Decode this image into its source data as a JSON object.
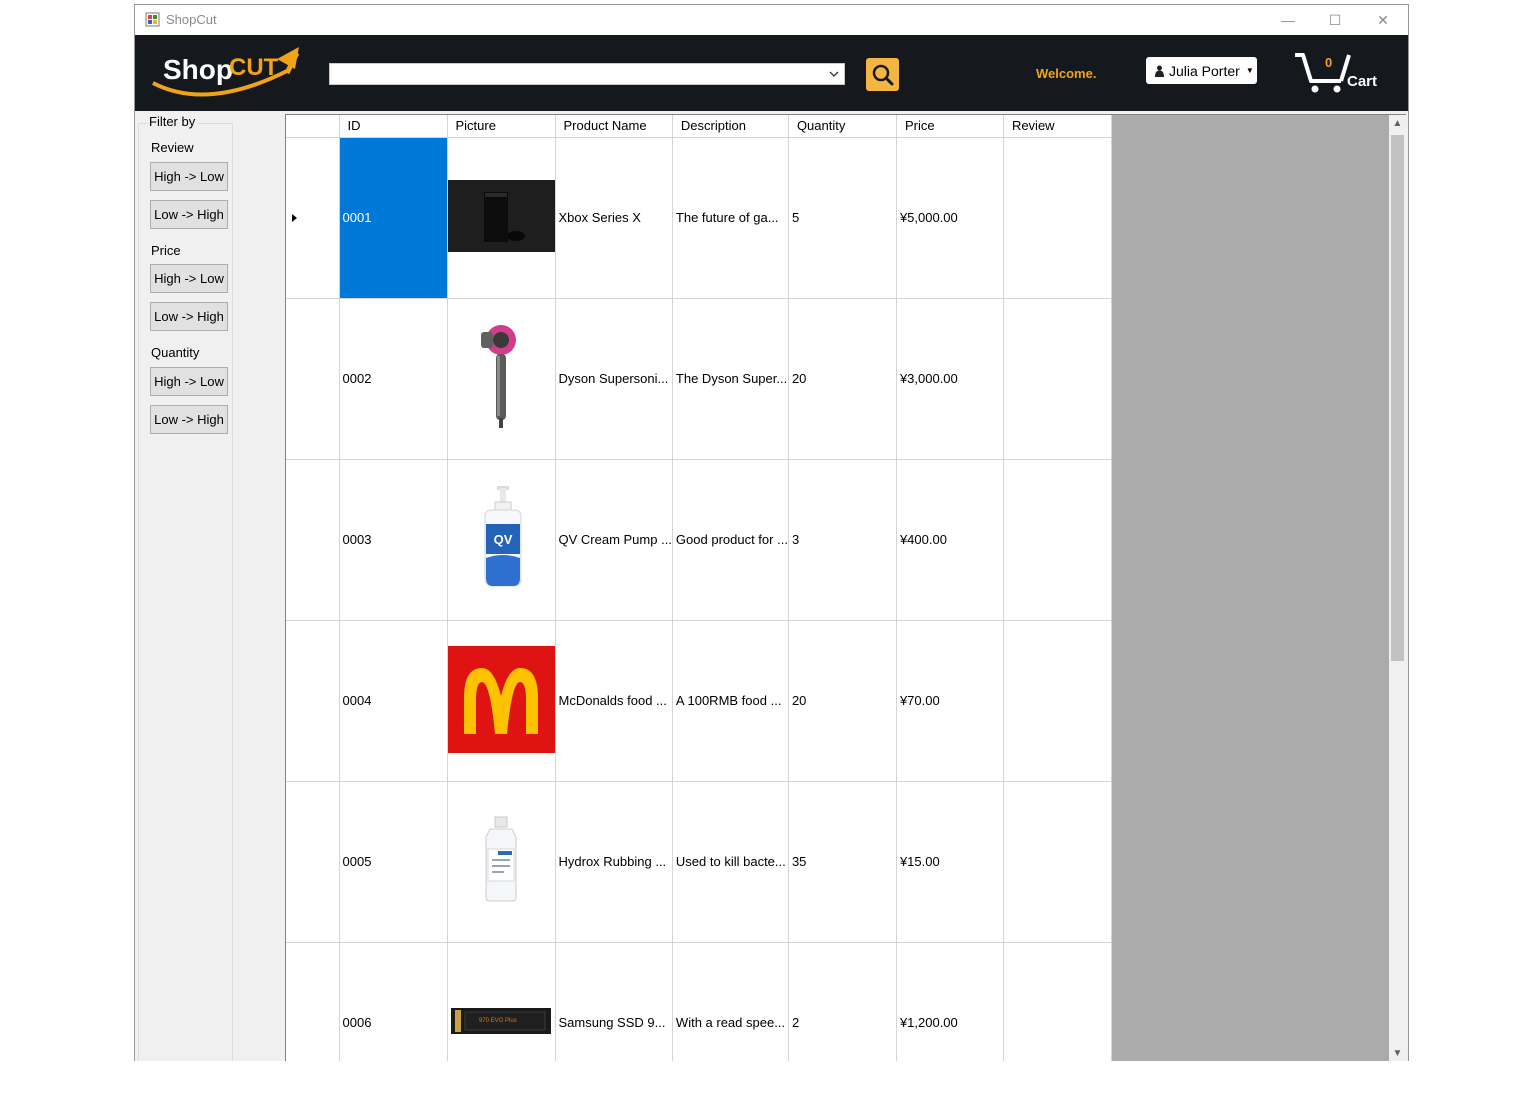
{
  "window": {
    "title": "ShopCut",
    "minimize_glyph": "—",
    "maximize_glyph": "☐",
    "close_glyph": "✕"
  },
  "header": {
    "logo_text_shop": "Shop",
    "logo_text_cut": "CUT",
    "search_value": "",
    "welcome_text": "Welcome.",
    "user_name": "Julia Porter",
    "cart_count": "0",
    "cart_label": "Cart",
    "accent_color": "#f4b542",
    "header_bg": "#15191e"
  },
  "sidebar": {
    "filter_title": "Filter by",
    "sections": [
      {
        "label": "Review",
        "high_low": "High -> Low",
        "low_high": "Low -> High"
      },
      {
        "label": "Price",
        "high_low": "High -> Low",
        "low_high": "Low -> High"
      },
      {
        "label": "Quantity",
        "high_low": "High -> Low",
        "low_high": "Low -> High"
      }
    ]
  },
  "grid": {
    "columns": [
      "ID",
      "Picture",
      "Product Name",
      "Description",
      "Quantity",
      "Price",
      "Review"
    ],
    "rows": [
      {
        "id": "0001",
        "picture": "xbox-series-x-image",
        "name": "Xbox Series X",
        "description": "The future of ga...",
        "quantity": "5",
        "price": "¥5,000.00",
        "review": ""
      },
      {
        "id": "0002",
        "picture": "dyson-hair-dryer-image",
        "name": "Dyson Supersoni...",
        "description": "The Dyson Super...",
        "quantity": "20",
        "price": "¥3,000.00",
        "review": ""
      },
      {
        "id": "0003",
        "picture": "qv-cream-pump-image",
        "name": "QV Cream Pump ...",
        "description": "Good product for ...",
        "quantity": "3",
        "price": "¥400.00",
        "review": ""
      },
      {
        "id": "0004",
        "picture": "mcdonalds-logo-image",
        "name": "McDonalds food ...",
        "description": "A 100RMB food ...",
        "quantity": "20",
        "price": "¥70.00",
        "review": ""
      },
      {
        "id": "0005",
        "picture": "hydrox-rubbing-alcohol-image",
        "name": "Hydrox Rubbing ...",
        "description": "Used to kill bacte...",
        "quantity": "35",
        "price": "¥15.00",
        "review": ""
      },
      {
        "id": "0006",
        "picture": "samsung-ssd-image",
        "name": "Samsung SSD 9...",
        "description": "With a read spee...",
        "quantity": "2",
        "price": "¥1,200.00",
        "review": ""
      }
    ],
    "selected_color": "#0078d7",
    "qv_logo_text": "QV",
    "ssd_label_text": "970 EVO Plus"
  }
}
